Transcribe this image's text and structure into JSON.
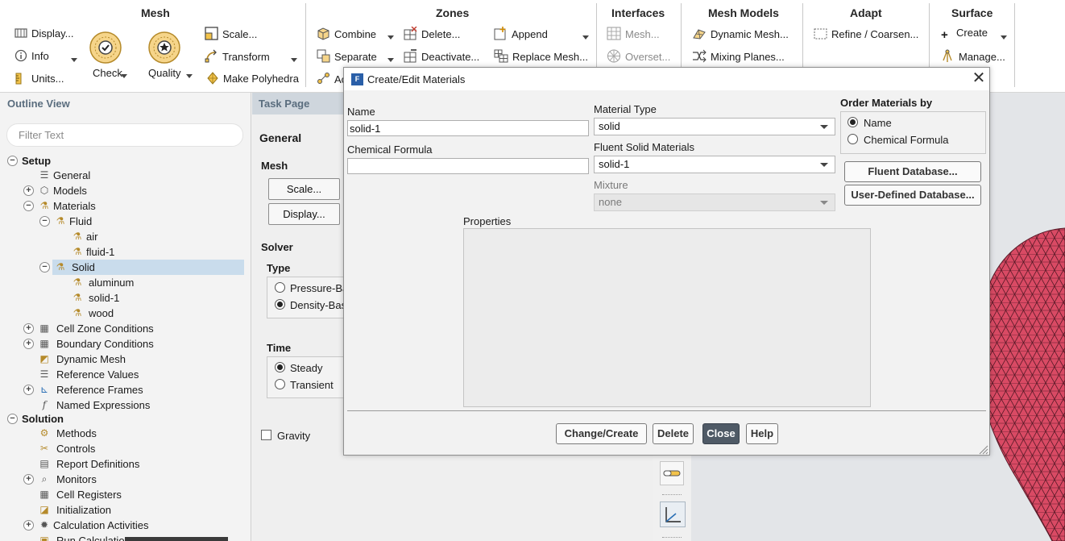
{
  "ribbon": {
    "groups": {
      "mesh": "Mesh",
      "zones": "Zones",
      "interfaces": "Interfaces",
      "mesh_models": "Mesh Models",
      "adapt": "Adapt",
      "surface": "Surface"
    },
    "mesh": {
      "display": "Display...",
      "info": "Info",
      "units": "Units...",
      "check": "Check",
      "quality": "Quality",
      "scale": "Scale...",
      "transform": "Transform",
      "make_polyhedra": "Make Polyhedra"
    },
    "zones": {
      "combine": "Combine",
      "separate": "Separate",
      "delete": "Delete...",
      "deactivate": "Deactivate...",
      "append": "Append",
      "replace_mesh": "Replace Mesh...",
      "cut_label": "Ac"
    },
    "interfaces": {
      "mesh": "Mesh...",
      "overset": "Overset..."
    },
    "mesh_models": {
      "dynamic_mesh": "Dynamic Mesh...",
      "mixing_planes": "Mixing Planes..."
    },
    "adapt": {
      "refine_coarsen": "Refine / Coarsen..."
    },
    "surface": {
      "create": "Create",
      "manage": "Manage..."
    }
  },
  "outline": {
    "title": "Outline View",
    "filter_placeholder": "Filter Text",
    "tree": {
      "setup": "Setup",
      "general": "General",
      "models": "Models",
      "materials": "Materials",
      "fluid": "Fluid",
      "air": "air",
      "fluid_1": "fluid-1",
      "solid": "Solid",
      "aluminum": "aluminum",
      "solid_1": "solid-1",
      "wood": "wood",
      "cell_zone_conditions": "Cell Zone Conditions",
      "boundary_conditions": "Boundary Conditions",
      "dynamic_mesh": "Dynamic Mesh",
      "reference_values": "Reference Values",
      "reference_frames": "Reference Frames",
      "named_expressions": "Named Expressions",
      "solution": "Solution",
      "methods": "Methods",
      "controls": "Controls",
      "report_definitions": "Report Definitions",
      "monitors": "Monitors",
      "cell_registers": "Cell Registers",
      "initialization": "Initialization",
      "calculation_activities": "Calculation Activities",
      "run_calculation": "Run Calculation"
    }
  },
  "task_page": {
    "title": "Task Page",
    "heading": "General",
    "mesh_section": "Mesh",
    "scale_button": "Scale...",
    "display_button": "Display...",
    "solver_section": "Solver",
    "type_label": "Type",
    "type_pressure": "Pressure-Ba",
    "type_density": "Density-Bas",
    "time_label": "Time",
    "time_steady": "Steady",
    "time_transient": "Transient",
    "gravity": "Gravity"
  },
  "dialog": {
    "title": "Create/Edit Materials",
    "name_label": "Name",
    "name_value": "solid-1",
    "chemical_formula_label": "Chemical Formula",
    "chemical_formula_value": "",
    "material_type_label": "Material Type",
    "material_type_value": "solid",
    "fluent_solid_materials_label": "Fluent Solid Materials",
    "fluent_solid_materials_value": "solid-1",
    "mixture_label": "Mixture",
    "mixture_value": "none",
    "order_by_label": "Order Materials by",
    "order_by_name": "Name",
    "order_by_chemical_formula": "Chemical Formula",
    "order_by_selected": "Name",
    "fluent_database_button": "Fluent Database...",
    "user_defined_database_button": "User-Defined Database...",
    "properties_label": "Properties",
    "change_create_button": "Change/Create",
    "delete_button": "Delete",
    "close_button": "Close",
    "help_button": "Help"
  },
  "colors": {
    "mesh_surface": "#d94a64",
    "mesh_edges": "#5a1a28",
    "selection": "#c9dcec",
    "primary_button": "#4f5a66"
  }
}
